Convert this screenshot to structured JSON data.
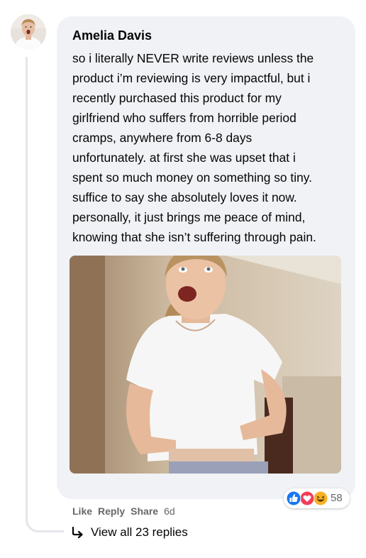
{
  "comment": {
    "author": "Amelia Davis",
    "text_lines": [
      "so i literally NEVER write reviews unless the",
      "product i’m reviewing is very impactful, but i",
      "recently purchased this product for my",
      "girlfriend who suffers from horrible period",
      "cramps, anywhere from 6-8 days",
      "unfortunately. at first she was upset that i",
      "spent so much money on something so tiny.",
      "suffice to say she absolutely loves it now.",
      "personally, it just brings me peace of mind,",
      "knowing that she isn’t suffering through pain."
    ],
    "reactions": {
      "icons": [
        "like-icon",
        "love-icon",
        "haha-icon"
      ],
      "count": "58"
    },
    "actions": {
      "like": "Like",
      "reply": "Reply",
      "share": "Share",
      "time": "6d"
    },
    "view_replies": "View all 23 replies"
  },
  "colors": {
    "bubble": "#f0f2f5",
    "like": "#1877f2",
    "love": "#f33e58",
    "haha": "#f7b125",
    "meta_text": "#65676b"
  }
}
